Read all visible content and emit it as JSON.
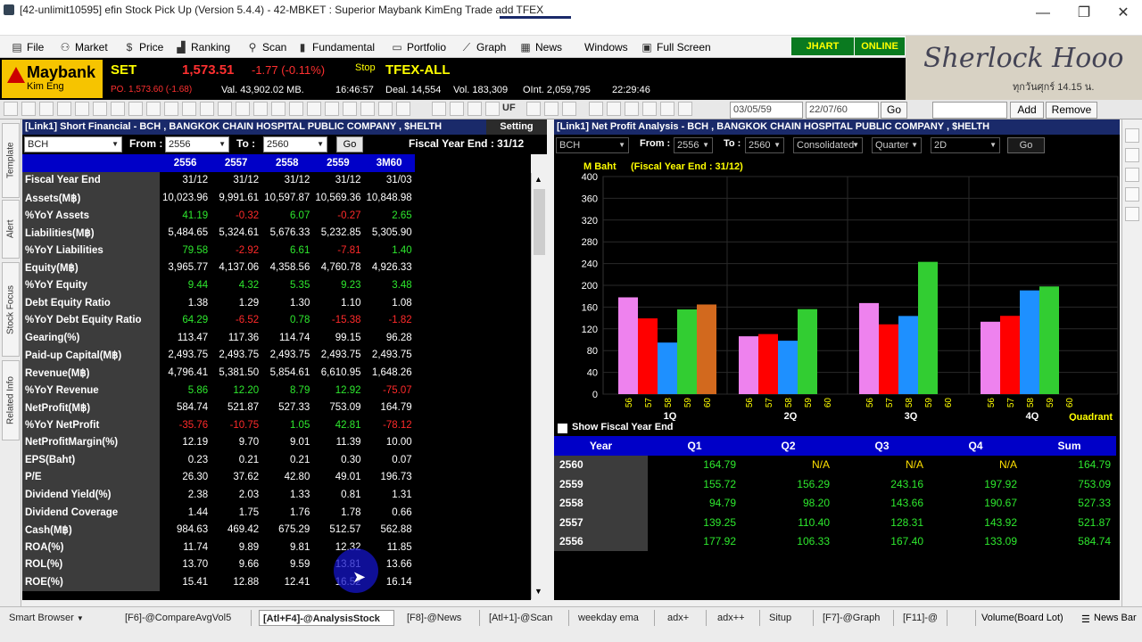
{
  "window": {
    "title": "[42-unlimit10595] efin Stock Pick Up (Version 5.4.4) - 42-MBKET : Superior Maybank KimEng Trade add TFEX",
    "min": "—",
    "max": "❐",
    "close": "✕"
  },
  "menu": [
    {
      "label": "File",
      "icon": "file-icon",
      "glyph": "▤"
    },
    {
      "label": "Market",
      "icon": "market-icon",
      "glyph": "⚇"
    },
    {
      "label": "Price",
      "icon": "dollar-icon",
      "glyph": "$"
    },
    {
      "label": "Ranking",
      "icon": "ranking-icon",
      "glyph": "▟"
    },
    {
      "label": "Scan",
      "icon": "scan-icon",
      "glyph": "⚲"
    },
    {
      "label": "Fundamental",
      "icon": "fundamental-icon",
      "glyph": "▮"
    },
    {
      "label": "Portfolio",
      "icon": "portfolio-icon",
      "glyph": "▭"
    },
    {
      "label": "Graph",
      "icon": "graph-icon",
      "glyph": "⟋"
    },
    {
      "label": "News",
      "icon": "news-icon",
      "glyph": "▦"
    },
    {
      "label": "Windows",
      "icon": "",
      "glyph": ""
    },
    {
      "label": "Full Screen",
      "icon": "fullscreen-icon",
      "glyph": "▣"
    }
  ],
  "status_badges": {
    "jhart": "JHART",
    "online": "ONLINE"
  },
  "banner": {
    "name": "Sherlock Hooo",
    "sub": "ทุกวันศุกร์ 14.15 น."
  },
  "brand": {
    "name": "Maybank",
    "sub": "Kim Eng",
    "color": "#f6c400"
  },
  "quote": {
    "set_label": "SET",
    "set_value": "1,573.51",
    "set_change": "-1.77 (-0.11%)",
    "set_state": "Stop",
    "po": "PO. 1,573.60 (-1.68)",
    "val": "Val. 43,902.02 MB.",
    "time": "16:46:57",
    "tfex_label": "TFEX-ALL",
    "deal": "Deal. 14,554",
    "vol": "Vol. 183,309",
    "oint": "OInt. 2,059,795",
    "tfex_time": "22:29:46"
  },
  "toolbar": {
    "date_from": "03/05/59",
    "date_to": "22/07/60",
    "go": "Go",
    "add": "Add",
    "remove": "Remove",
    "uf": "UF"
  },
  "side_tabs": [
    "Template",
    "Alert",
    "Stock Focus",
    "Related Info"
  ],
  "left_panel": {
    "title": "[Link1] Short Financial - BCH , BANGKOK CHAIN HOSPITAL PUBLIC COMPANY , $HELTH",
    "setting": "Setting",
    "symbol": "BCH",
    "from_label": "From :",
    "from": "2556",
    "to_label": "To :",
    "to": "2560",
    "go": "Go",
    "fiscal": "Fiscal  Year  End  :  31/12",
    "columns": [
      "2556",
      "2557",
      "2558",
      "2559",
      "3M60"
    ],
    "rows": [
      {
        "label": "Fiscal Year End",
        "ind": false,
        "vals": [
          "31/12",
          "31/12",
          "31/12",
          "31/12",
          "31/03"
        ]
      },
      {
        "label": "Assets(M฿)",
        "ind": false,
        "vals": [
          "10,023.96",
          "9,991.61",
          "10,597.87",
          "10,569.36",
          "10,848.98"
        ]
      },
      {
        "label": "%YoY Assets",
        "ind": true,
        "vals": [
          "41.19",
          "-0.32",
          "6.07",
          "-0.27",
          "2.65"
        ]
      },
      {
        "label": "Liabilities(M฿)",
        "ind": false,
        "vals": [
          "5,484.65",
          "5,324.61",
          "5,676.33",
          "5,232.85",
          "5,305.90"
        ]
      },
      {
        "label": "%YoY Liabilities",
        "ind": true,
        "vals": [
          "79.58",
          "-2.92",
          "6.61",
          "-7.81",
          "1.40"
        ]
      },
      {
        "label": "Equity(M฿)",
        "ind": false,
        "vals": [
          "3,965.77",
          "4,137.06",
          "4,358.56",
          "4,760.78",
          "4,926.33"
        ]
      },
      {
        "label": "%YoY Equity",
        "ind": true,
        "vals": [
          "9.44",
          "4.32",
          "5.35",
          "9.23",
          "3.48"
        ]
      },
      {
        "label": "Debt Equity Ratio",
        "ind": false,
        "vals": [
          "1.38",
          "1.29",
          "1.30",
          "1.10",
          "1.08"
        ]
      },
      {
        "label": "%YoY Debt Equity Ratio",
        "ind": true,
        "vals": [
          "64.29",
          "-6.52",
          "0.78",
          "-15.38",
          "-1.82"
        ]
      },
      {
        "label": "Gearing(%)",
        "ind": false,
        "vals": [
          "113.47",
          "117.36",
          "114.74",
          "99.15",
          "96.28"
        ]
      },
      {
        "label": "Paid-up Capital(M฿)",
        "ind": false,
        "vals": [
          "2,493.75",
          "2,493.75",
          "2,493.75",
          "2,493.75",
          "2,493.75"
        ]
      },
      {
        "label": "Revenue(M฿)",
        "ind": false,
        "vals": [
          "4,796.41",
          "5,381.50",
          "5,854.61",
          "6,610.95",
          "1,648.26"
        ]
      },
      {
        "label": "%YoY Revenue",
        "ind": true,
        "vals": [
          "5.86",
          "12.20",
          "8.79",
          "12.92",
          "-75.07"
        ]
      },
      {
        "label": "NetProfit(M฿)",
        "ind": false,
        "vals": [
          "584.74",
          "521.87",
          "527.33",
          "753.09",
          "164.79"
        ]
      },
      {
        "label": "%YoY NetProfit",
        "ind": true,
        "vals": [
          "-35.76",
          "-10.75",
          "1.05",
          "42.81",
          "-78.12"
        ]
      },
      {
        "label": "NetProfitMargin(%)",
        "ind": false,
        "vals": [
          "12.19",
          "9.70",
          "9.01",
          "11.39",
          "10.00"
        ]
      },
      {
        "label": "EPS(Baht)",
        "ind": false,
        "vals": [
          "0.23",
          "0.21",
          "0.21",
          "0.30",
          "0.07"
        ]
      },
      {
        "label": "P/E",
        "ind": false,
        "vals": [
          "26.30",
          "37.62",
          "42.80",
          "49.01",
          "196.73"
        ]
      },
      {
        "label": "Dividend Yield(%)",
        "ind": false,
        "vals": [
          "2.38",
          "2.03",
          "1.33",
          "0.81",
          "1.31"
        ]
      },
      {
        "label": "Dividend Coverage",
        "ind": false,
        "vals": [
          "1.44",
          "1.75",
          "1.76",
          "1.78",
          "0.66"
        ]
      },
      {
        "label": "Cash(M฿)",
        "ind": false,
        "vals": [
          "984.63",
          "469.42",
          "675.29",
          "512.57",
          "562.88"
        ]
      },
      {
        "label": "ROA(%)",
        "ind": false,
        "vals": [
          "11.74",
          "9.89",
          "9.81",
          "12.32",
          "11.85"
        ]
      },
      {
        "label": "ROL(%)",
        "ind": false,
        "vals": [
          "13.70",
          "9.66",
          "9.59",
          "13.81",
          "13.66"
        ]
      },
      {
        "label": "ROE(%)",
        "ind": false,
        "vals": [
          "15.41",
          "12.88",
          "12.41",
          "16.52",
          "16.14"
        ]
      }
    ]
  },
  "right_panel": {
    "title": "[Link1] Net Profit Analysis - BCH , BANGKOK CHAIN HOSPITAL PUBLIC COMPANY , $HELTH",
    "symbol": "BCH",
    "from_label": "From :",
    "from": "2556",
    "to_label": "To :",
    "to": "2560",
    "consolidated": "Consolidated",
    "period": "Quarter",
    "view": "2D",
    "go": "Go",
    "show_fiscal": "Show Fiscal Year End",
    "table_headers": [
      "Year",
      "Q1",
      "Q2",
      "Q3",
      "Q4",
      "Sum"
    ],
    "table_rows": [
      [
        "2560",
        "164.79",
        "N/A",
        "N/A",
        "N/A",
        "164.79"
      ],
      [
        "2559",
        "155.72",
        "156.29",
        "243.16",
        "197.92",
        "753.09"
      ],
      [
        "2558",
        "94.79",
        "98.20",
        "143.66",
        "190.67",
        "527.33"
      ],
      [
        "2557",
        "139.25",
        "110.40",
        "128.31",
        "143.92",
        "521.87"
      ],
      [
        "2556",
        "177.92",
        "106.33",
        "167.40",
        "133.09",
        "584.74"
      ]
    ]
  },
  "chart_data": {
    "type": "bar",
    "title": "(Fiscal Year End : 31/12)",
    "ylabel": "M Baht",
    "xlabel": "Quadrant",
    "ylim": [
      0,
      400
    ],
    "yticks": [
      0,
      40,
      80,
      120,
      160,
      200,
      240,
      280,
      320,
      360,
      400
    ],
    "categories": [
      "1Q",
      "2Q",
      "3Q",
      "4Q"
    ],
    "year_labels": [
      "56",
      "57",
      "58",
      "59",
      "60"
    ],
    "colors": [
      "#ee82ee",
      "#ff0000",
      "#1e90ff",
      "#32cd32",
      "#d2691e"
    ],
    "series": [
      {
        "name": "56",
        "values": [
          177.92,
          106.33,
          167.4,
          133.09
        ]
      },
      {
        "name": "57",
        "values": [
          139.25,
          110.4,
          128.31,
          143.92
        ]
      },
      {
        "name": "58",
        "values": [
          94.79,
          98.2,
          143.66,
          190.67
        ]
      },
      {
        "name": "59",
        "values": [
          155.72,
          156.29,
          243.16,
          197.92
        ]
      },
      {
        "name": "60",
        "values": [
          164.79,
          null,
          null,
          null
        ]
      }
    ]
  },
  "taskbar": {
    "smart": "Smart Browser",
    "tabs": [
      "[F6]-@CompareAvgVol5",
      "[Atl+F4]-@AnalysisStock",
      "[F8]-@News",
      "[Atl+1]-@Scan",
      "weekday ema",
      "adx+",
      "adx++",
      "Situp",
      "[F7]-@Graph",
      "[F11]-@"
    ],
    "active": 1,
    "volume": "Volume(Board Lot)",
    "newsbar": "News Bar"
  }
}
